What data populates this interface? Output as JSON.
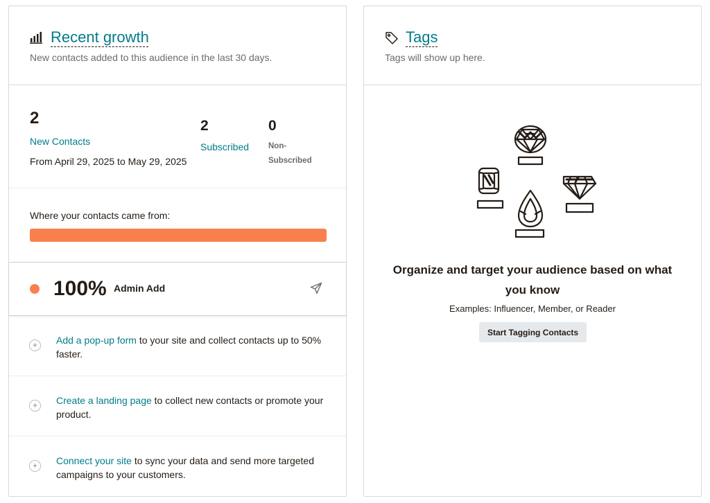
{
  "growth": {
    "title": "Recent growth",
    "subtitle": "New contacts added to this audience in the last 30 days.",
    "new_contacts_count": "2",
    "new_contacts_label": "New Contacts",
    "date_range": "From April 29, 2025 to May 29, 2025",
    "subscribed_count": "2",
    "subscribed_label": "Subscribed",
    "nonsubscribed_count": "0",
    "nonsubscribed_label_1": "Non-",
    "nonsubscribed_label_2": "Subscribed",
    "sources_label": "Where your contacts came from:",
    "source": {
      "percent": "100%",
      "name": "Admin Add",
      "share": 1.0,
      "color": "#f9804e"
    },
    "tips": [
      {
        "link": "Add a pop-up form",
        "rest": " to your site and collect contacts up to 50% faster."
      },
      {
        "link": "Create a landing page",
        "rest": " to collect new contacts or promote your product."
      },
      {
        "link": "Connect your site",
        "rest": " to sync your data and send more targeted campaigns to your customers."
      }
    ],
    "icons": {
      "header": "bar-chart-icon",
      "send": "paper-plane-icon",
      "tip": "plus-circle-icon"
    }
  },
  "tags": {
    "title": "Tags",
    "subtitle": "Tags will show up here.",
    "headline": "Organize and target your audience based on what you know",
    "examples": "Examples: Influencer, Member, or Reader",
    "button": "Start Tagging Contacts",
    "icons": {
      "header": "tag-icon",
      "illustration": "gems-illustration"
    }
  },
  "colors": {
    "accent": "#007c89",
    "source": "#f9804e",
    "text": "#241c15"
  }
}
